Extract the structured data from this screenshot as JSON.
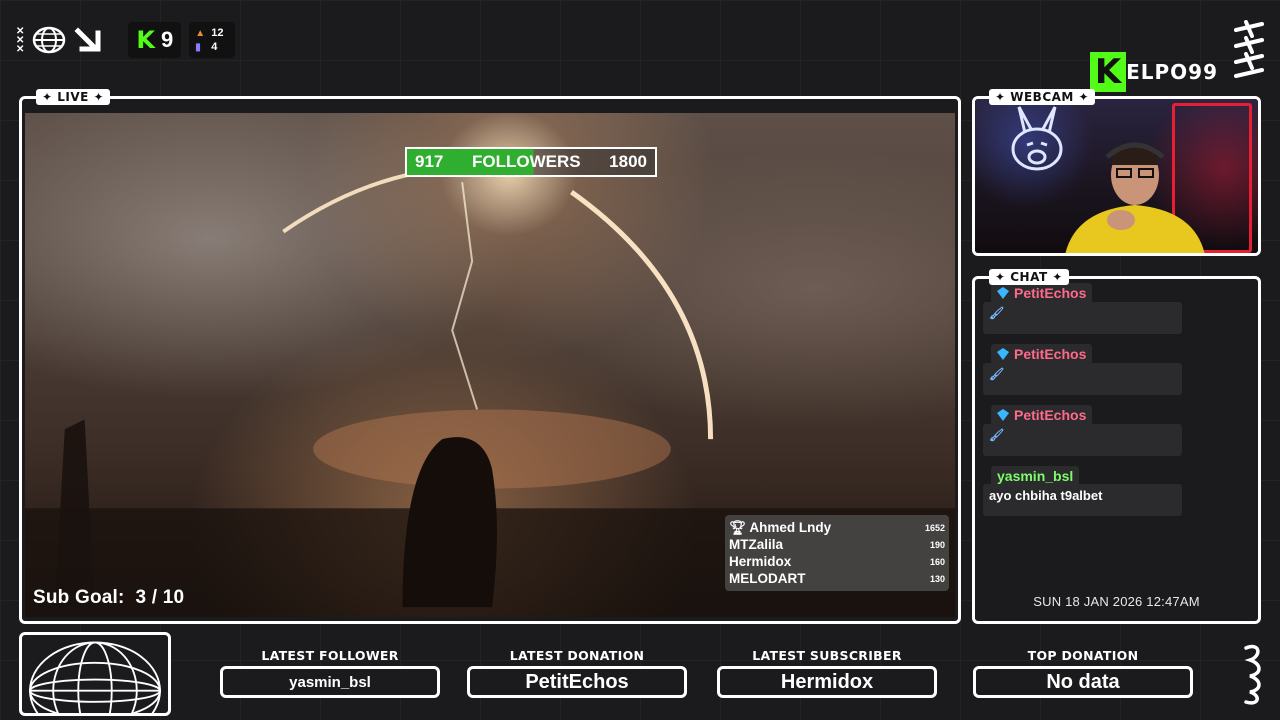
{
  "top_left": {
    "kick_count": "9",
    "stat_top": "12",
    "stat_bottom": "4"
  },
  "brand": {
    "letter": "K",
    "name": "ELPO99"
  },
  "stream": {
    "tag": "LIVE",
    "followers": {
      "current": "917",
      "label": "FOLLOWERS",
      "goal": "1800",
      "progress_fraction": 0.51
    },
    "sub_goal": {
      "label": "Sub Goal:",
      "value": "3 / 10"
    },
    "leaderboard": [
      {
        "name": "Ahmed Lndy",
        "value": "1652",
        "icon": "trophy-icon"
      },
      {
        "name": "MTZalila",
        "value": "190"
      },
      {
        "name": "Hermidox",
        "value": "160"
      },
      {
        "name": "MELODART",
        "value": "130"
      }
    ]
  },
  "webcam": {
    "tag": "WEBCAM"
  },
  "chat": {
    "tag": "CHAT",
    "messages": [
      {
        "user": "PetitEchos",
        "badge": "gem-icon",
        "text": "🖌"
      },
      {
        "user": "PetitEchos",
        "badge": "gem-icon",
        "text": "🖌"
      },
      {
        "user": "PetitEchos",
        "badge": "gem-icon",
        "text": "🖌"
      },
      {
        "user": "yasmin_bsl",
        "text": "ayo chbiha t9albet"
      }
    ],
    "clock": "SUN 18 JAN 2026 12:47AM"
  },
  "bottom": {
    "latest_follower": {
      "label": "LATEST FOLLOWER",
      "value": "yasmin_bsl"
    },
    "latest_donation": {
      "label": "LATEST DONATION",
      "value": "PetitEchos"
    },
    "latest_subscriber": {
      "label": "LATEST SUBSCRIBER",
      "value": "Hermidox"
    },
    "top_donation": {
      "label": "TOP DONATION",
      "value": "No data"
    }
  },
  "colors": {
    "kick_green": "#53fc18",
    "background": "#1b1b1d",
    "chat_user_pink": "#ff6a8a",
    "chat_user_green": "#7dfc6a"
  }
}
